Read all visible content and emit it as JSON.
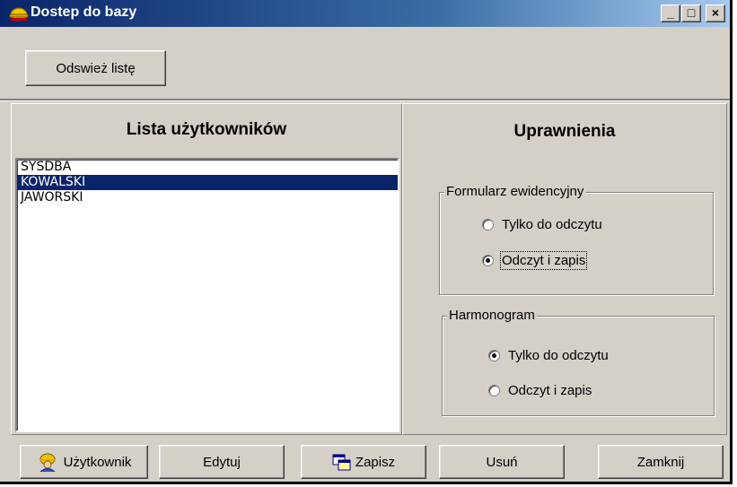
{
  "window": {
    "title": "Dostep do bazy",
    "controls": {
      "minimize": "_",
      "maximize": "□",
      "close": "×"
    }
  },
  "toolbar": {
    "refresh_label": "Odswież listę"
  },
  "users_panel": {
    "heading": "Lista użytkowników",
    "users": [
      "SYSDBA",
      "KOWALSKI",
      "JAWORSKI"
    ],
    "selected_index": 1
  },
  "permissions_panel": {
    "heading": "Uprawnienia",
    "groups": [
      {
        "title": "Formularz ewidencyjny",
        "options": [
          "Tylko do odczytu",
          "Odczyt i zapis"
        ],
        "selected": "Odczyt i zapis"
      },
      {
        "title": "Harmonogram",
        "options": [
          "Tylko do odczytu",
          "Odczyt i zapis"
        ],
        "selected": "Tylko do odczytu"
      }
    ]
  },
  "bottom_buttons": {
    "user": "Użytkownik",
    "edit": "Edytuj",
    "save": "Zapisz",
    "delete": "Usuń",
    "close": "Zamknij"
  },
  "colors": {
    "face": "#d4d0c8",
    "selection": "#0a246a",
    "title_start": "#0a246a",
    "title_end": "#a6caf0"
  },
  "icons": [
    "user-hardhat-icon",
    "save-window-icon"
  ]
}
